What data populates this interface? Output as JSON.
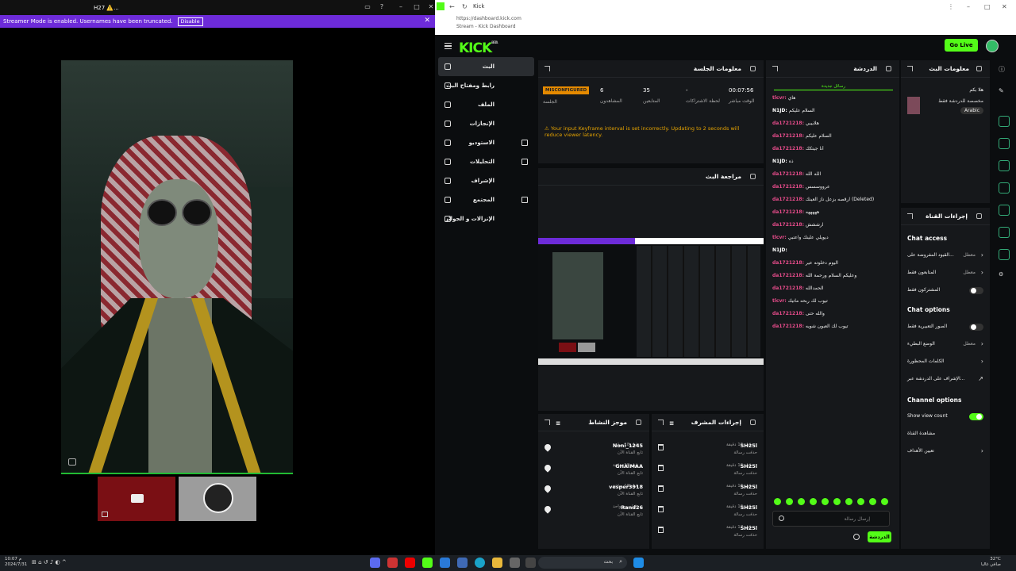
{
  "left_window": {
    "title": "H27 ⚠️...",
    "banner_text": "Streamer Mode is enabled. Usernames have been truncated.",
    "banner_button": "Disable"
  },
  "browser": {
    "tab_title": "Kick",
    "url": "https://dashboard.kick.com",
    "subtitle": "Stream - Kick Dashboard"
  },
  "header": {
    "logo": "KICK",
    "logo_badge": "BETA",
    "go_live": "Go Live"
  },
  "sidebar": {
    "items": [
      {
        "label": "البث"
      },
      {
        "label": "رابط ومفتاح البث"
      },
      {
        "label": "الملف"
      },
      {
        "label": "الإنجازات"
      },
      {
        "label": "الاستوديو"
      },
      {
        "label": "التحليلات"
      },
      {
        "label": "الإشراف"
      },
      {
        "label": "المجتمع"
      },
      {
        "label": "الإنزالات و الجوائز"
      }
    ]
  },
  "session": {
    "title": "معلومات الجلسة",
    "status": "MISCONFIGURED",
    "status_label": "الجلسة",
    "stats": [
      {
        "value": "00:07:56",
        "label": "الوقت مباشر"
      },
      {
        "value": "-",
        "label": "لحظة الاشتراكات"
      },
      {
        "value": "35",
        "label": "المتابعين"
      },
      {
        "value": "6",
        "label": "المشاهدون"
      }
    ],
    "warning": "Your input Keyframe interval is set incorrectly. Updating to 2 seconds will reduce viewer latency."
  },
  "preview": {
    "title": "مراجعة البث"
  },
  "activity": {
    "title": "موجز النشاط",
    "rows": [
      {
        "name": "Noni_1245",
        "sub": "تابع القناة الآن",
        "time": "قبل 18 ساعة"
      },
      {
        "name": "GHAIMAA",
        "sub": "تابع القناة الآن",
        "time": "قبل 18 ساعة"
      },
      {
        "name": "vesper3918",
        "sub": "تابع القناة الآن",
        "time": "قبل 18 ساعة"
      },
      {
        "name": "Rand26",
        "sub": "تابع القناة الآن",
        "time": "قبل يوم واحد"
      }
    ]
  },
  "mod_actions": {
    "title": "إجراءات المشرف",
    "rows": [
      {
        "name": "SH25l",
        "sub": "حذفت رسالة",
        "time": "قبل 16 دقيقة"
      },
      {
        "name": "SH25l",
        "sub": "حذفت رسالة",
        "time": "قبل 16 دقيقة"
      },
      {
        "name": "SH25l",
        "sub": "حذفت رسالة",
        "time": "قبل 16 دقيقة"
      },
      {
        "name": "SH25l",
        "sub": "حذفت رسالة",
        "time": "قبل 16 دقيقة"
      },
      {
        "name": "SH25l",
        "sub": "حذفت رسالة",
        "time": "قبل 17 دقيقة"
      }
    ]
  },
  "chat": {
    "title": "الدردشة",
    "new_messages": "رسائل جديدة",
    "messages": [
      {
        "user": "tlcvr:",
        "text": "هاي",
        "color": "#e74c8b"
      },
      {
        "user": "N1JD:",
        "text": "السلام عليكم",
        "color": "#ffffff"
      },
      {
        "user": "da1721218:",
        "text": "هلابيبي",
        "color": "#e74c8b"
      },
      {
        "user": "da1721218:",
        "text": "السلام عليكم",
        "color": "#e74c8b"
      },
      {
        "user": "da1721218:",
        "text": "أنا جيتكك",
        "color": "#e74c8b"
      },
      {
        "user": "N1JD:",
        "text": "ذه",
        "color": "#ffffff"
      },
      {
        "user": "da1721218:",
        "text": "الله الله",
        "color": "#e74c8b"
      },
      {
        "user": "da1721218:",
        "text": "عرووسسس",
        "color": "#e74c8b"
      },
      {
        "user": "da1721218:",
        "text": "ارقصه بزعل ناز العينك (Deleted)",
        "color": "#e74c8b"
      },
      {
        "user": "da1721218:",
        "text": "هههههه",
        "color": "#e74c8b"
      },
      {
        "user": "da1721218:",
        "text": "ارششش",
        "color": "#e74c8b"
      },
      {
        "user": "tlcvr:",
        "text": "ديويلي علينك واعتبي",
        "color": "#e74c8b"
      },
      {
        "user": "N1JD:",
        "text": "",
        "color": "#ffffff"
      },
      {
        "user": "da1721218:",
        "text": "اليوم دخلوته عير",
        "color": "#e74c8b"
      },
      {
        "user": "da1721218:",
        "text": "وعليكم السلام ورحمة الله",
        "color": "#e74c8b"
      },
      {
        "user": "da1721218:",
        "text": "الحمدالله",
        "color": "#e74c8b"
      },
      {
        "user": "tlcvr:",
        "text": "تيوب لك ربحه ماتيك",
        "color": "#e74c8b"
      },
      {
        "user": "da1721218:",
        "text": "والله حتى",
        "color": "#e74c8b"
      },
      {
        "user": "da1721218:",
        "text": "تيوب لك العبون شويه",
        "color": "#e74c8b"
      }
    ],
    "input_placeholder": "إرسال رسالة",
    "send": "الدردشة"
  },
  "stream_info": {
    "title": "معلومات البث",
    "name": "هلا بكم",
    "category": "مخصصة للدردشة فقط",
    "language": "Arabic"
  },
  "channel_actions": {
    "title": "إجراءات القناة",
    "chat_access": "Chat access",
    "chat_options": "Chat options",
    "channel_options": "Channel options",
    "items": [
      {
        "label": "القيود المفروضة على...",
        "value": "معطل"
      },
      {
        "label": "المتابعون فقط",
        "value": "معطل"
      },
      {
        "label": "المشتركون فقط"
      },
      {
        "label": "الصور التعبيرية فقط"
      },
      {
        "label": "الوضع البطيء",
        "value": "معطل"
      },
      {
        "label": "الكلمات المحظورة"
      },
      {
        "label": "الإشراف على الدردشة عبر..."
      },
      {
        "label": "Show view count"
      },
      {
        "label": "مشاهدة القناة"
      },
      {
        "label": "تعيين الأهداف"
      }
    ]
  },
  "taskbar": {
    "search": "بحث",
    "time": "10:07 م",
    "date": "2024/7/31",
    "weather": "32°C",
    "weather_text": "صافي غالبا"
  }
}
